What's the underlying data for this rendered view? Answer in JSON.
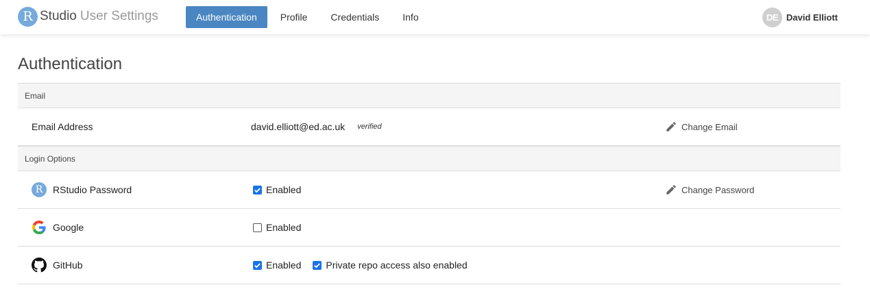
{
  "header": {
    "logo_letter": "R",
    "brand": "Studio",
    "brand_sub": "User Settings",
    "tabs": [
      {
        "label": "Authentication",
        "active": true
      },
      {
        "label": "Profile",
        "active": false
      },
      {
        "label": "Credentials",
        "active": false
      },
      {
        "label": "Info",
        "active": false
      }
    ],
    "user": {
      "initials": "DE",
      "name": "David Elliott"
    }
  },
  "page": {
    "title": "Authentication"
  },
  "email_section": {
    "heading": "Email",
    "label": "Email Address",
    "value": "david.elliott@ed.ac.uk",
    "status": "verified",
    "action": "Change Email"
  },
  "login_section": {
    "heading": "Login Options",
    "rows": [
      {
        "icon": "rstudio-icon",
        "icon_letter": "R",
        "label": "RStudio Password",
        "enabled_label": "Enabled",
        "enabled": true,
        "action": "Change Password"
      },
      {
        "icon": "google-icon",
        "label": "Google",
        "enabled_label": "Enabled",
        "enabled": false
      },
      {
        "icon": "github-icon",
        "label": "GitHub",
        "enabled_label": "Enabled",
        "enabled": true,
        "extra_label": "Private repo access also enabled",
        "extra_enabled": true
      }
    ]
  },
  "colors": {
    "accent": "#4a86c1",
    "logo": "#75aadb",
    "checkbox": "#1a73e8"
  }
}
